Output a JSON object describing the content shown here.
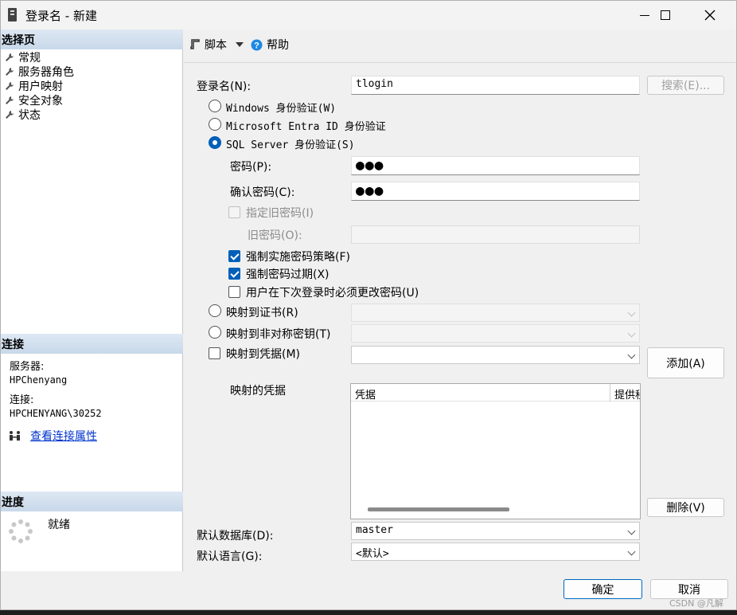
{
  "window": {
    "title": "登录名 - 新建"
  },
  "left": {
    "select_page_header": "选择页",
    "pages": [
      {
        "label": "常规"
      },
      {
        "label": "服务器角色"
      },
      {
        "label": "用户映射"
      },
      {
        "label": "安全对象"
      },
      {
        "label": "状态"
      }
    ],
    "connection_header": "连接",
    "server_label": "服务器:",
    "server_value": "HPChenyang",
    "connection_label": "连接:",
    "connection_value": "HPCHENYANG\\30252",
    "view_props_link": "查看连接属性",
    "progress_header": "进度",
    "progress_status": "就绪"
  },
  "toolbar": {
    "script_label": "脚本",
    "help_label": "帮助"
  },
  "form": {
    "login_name_label": "登录名(N):",
    "login_name_value": "tlogin",
    "search_button": "搜索(E)...",
    "auth_windows": "Windows 身份验证(W)",
    "auth_entra": "Microsoft Entra ID 身份验证",
    "auth_sql": "SQL Server 身份验证(S)",
    "password_label": "密码(P):",
    "password_value": "●●●",
    "confirm_password_label": "确认密码(C):",
    "confirm_password_value": "●●●",
    "specify_old_password": "指定旧密码(I)",
    "old_password_label": "旧密码(O):",
    "enforce_policy": "强制实施密码策略(F)",
    "enforce_expiration": "强制密码过期(X)",
    "must_change": "用户在下次登录时必须更改密码(U)",
    "map_certificate": "映射到证书(R)",
    "map_asymmetric_key": "映射到非对称密钥(T)",
    "map_credential": "映射到凭据(M)",
    "add_button": "添加(A)",
    "mapped_credentials_label": "映射的凭据",
    "grid_columns": [
      "凭据",
      "提供程"
    ],
    "remove_button": "删除(V)",
    "default_db_label": "默认数据库(D):",
    "default_db_value": "master",
    "default_lang_label": "默认语言(G):",
    "default_lang_value": "<默认>"
  },
  "footer": {
    "ok_button": "确定",
    "cancel_button": "取消",
    "watermark": "CSDN @凡解"
  },
  "colors": {
    "accent": "#005fb8",
    "header_gradient": "#c8d8ea",
    "link": "#0033cc"
  }
}
